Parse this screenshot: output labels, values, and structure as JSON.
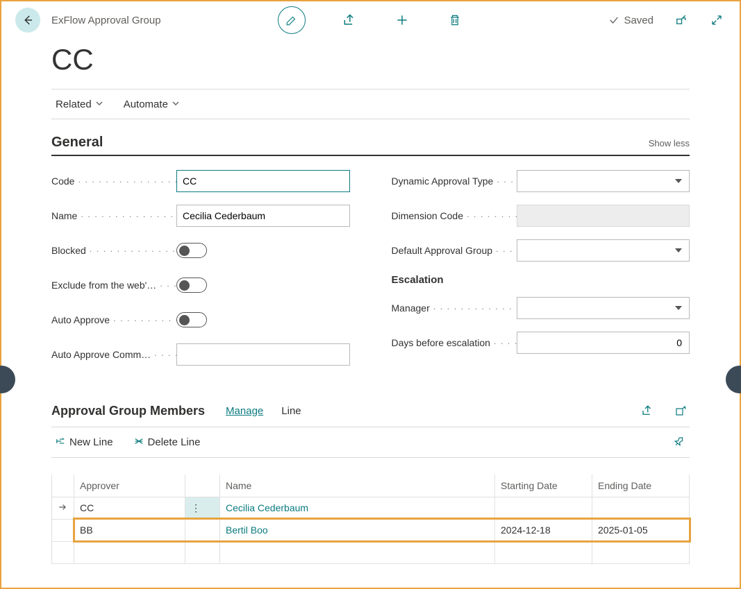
{
  "header": {
    "page_type": "ExFlow Approval Group",
    "saved_label": "Saved"
  },
  "page_title": "CC",
  "toolbar": {
    "related": "Related",
    "automate": "Automate"
  },
  "general": {
    "section_title": "General",
    "show_less": "Show less",
    "labels": {
      "code": "Code",
      "name": "Name",
      "blocked": "Blocked",
      "exclude": "Exclude from the web'…",
      "auto_approve": "Auto Approve",
      "auto_approve_comm": "Auto Approve Comm…",
      "dynamic_approval_type": "Dynamic Approval Type",
      "dimension_code": "Dimension Code",
      "default_approval_group": "Default Approval Group",
      "escalation": "Escalation",
      "manager": "Manager",
      "days_before_escalation": "Days before escalation"
    },
    "values": {
      "code": "CC",
      "name": "Cecilia Cederbaum",
      "blocked": false,
      "exclude": false,
      "auto_approve": false,
      "auto_approve_comm": "",
      "dynamic_approval_type": "",
      "dimension_code": "",
      "default_approval_group": "",
      "manager": "",
      "days_before_escalation": "0"
    }
  },
  "members": {
    "section_title": "Approval Group Members",
    "tabs": {
      "manage": "Manage",
      "line": "Line"
    },
    "actions": {
      "new_line": "New Line",
      "delete_line": "Delete Line"
    },
    "columns": {
      "approver": "Approver",
      "name": "Name",
      "starting_date": "Starting Date",
      "ending_date": "Ending Date"
    },
    "rows": [
      {
        "approver": "CC",
        "name": "Cecilia Cederbaum",
        "starting_date": "",
        "ending_date": ""
      },
      {
        "approver": "BB",
        "name": "Bertil Boo",
        "starting_date": "2024-12-18",
        "ending_date": "2025-01-05"
      }
    ]
  }
}
